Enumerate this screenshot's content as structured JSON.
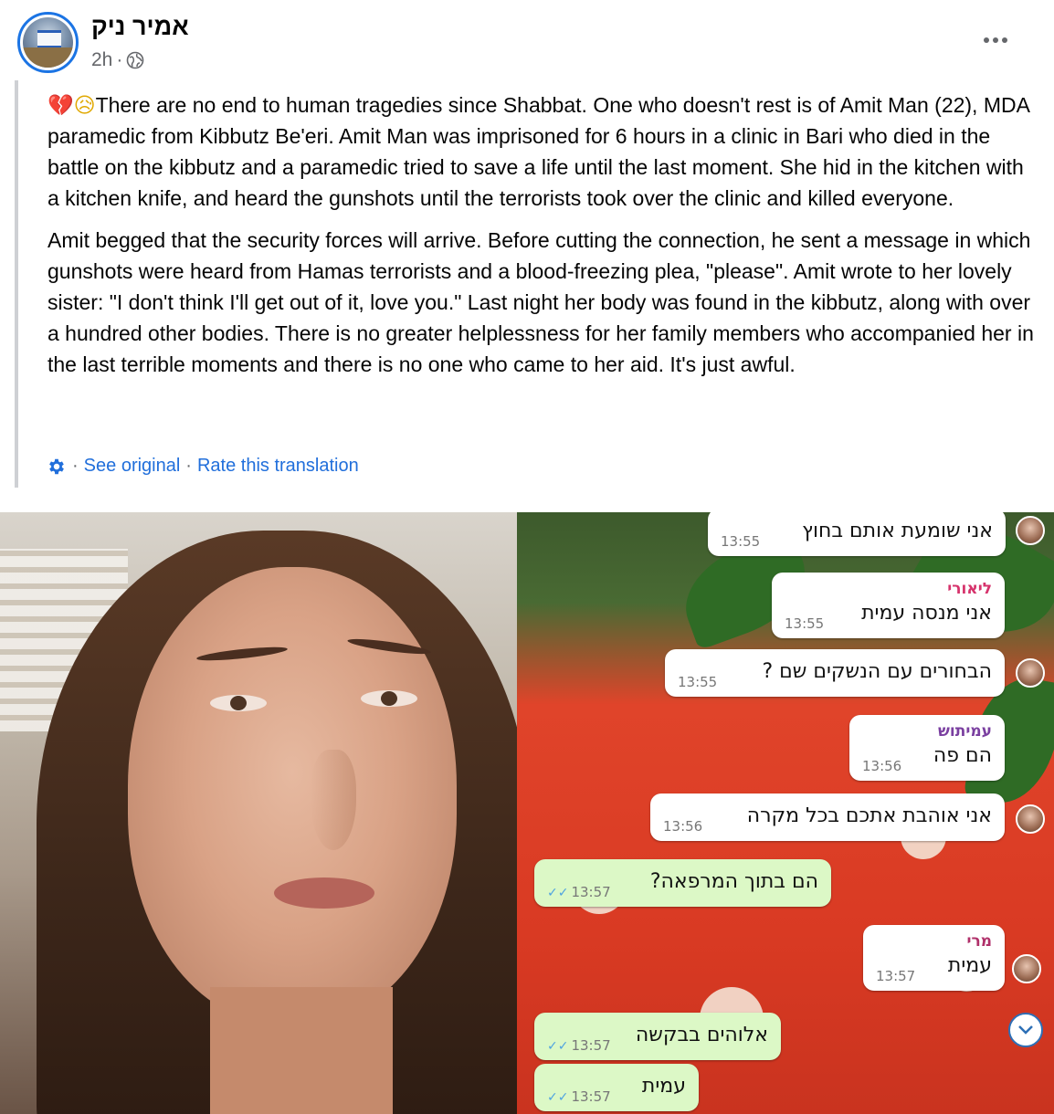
{
  "post": {
    "author": "אמיר ניק",
    "time": "2h",
    "time_separator": "·",
    "privacy_icon": "globe-icon",
    "more_icon": "more-options-icon"
  },
  "content": {
    "emoji_1": "💔",
    "emoji_2": "😥",
    "paragraph_1": "There are no end to human tragedies since Shabbat. One who doesn't rest is of Amit Man (22), MDA paramedic from Kibbutz Be'eri. Amit Man was imprisoned for 6 hours in a clinic in Bari who died in the battle on the kibbutz and a paramedic tried to save a life until the last moment. She hid in the kitchen with a kitchen knife, and heard the gunshots until the terrorists took over the clinic and killed everyone.",
    "paragraph_2": "Amit begged that the security forces will arrive. Before cutting the connection, he sent a message in which gunshots were heard from Hamas terrorists and a blood-freezing plea, \"please\". Amit wrote to her lovely sister: \"I don't think I'll get out of it, love you.\" Last night her body was found in the kibbutz, along with over a hundred other bodies. There is no greater helplessness for her family members who accompanied her in the last terrible moments and there is no one who came to her aid. It's just awful."
  },
  "translation": {
    "separator": "·",
    "see_original": "See original",
    "rate": "Rate this translation"
  },
  "chat": {
    "messages": [
      {
        "type": "in",
        "sender": "",
        "text": "אני שומעת אותם בחוץ",
        "time": "13:55"
      },
      {
        "type": "in",
        "sender": "ליאורי",
        "sender_color": "#d6336c",
        "text": "אני מנסה עמית",
        "time": "13:55"
      },
      {
        "type": "in",
        "sender": "",
        "text": "הבחורים עם הנשקים שם ?",
        "time": "13:55"
      },
      {
        "type": "in",
        "sender": "עמיתוש",
        "sender_color": "#7a3fa0",
        "text": "הם פה",
        "time": "13:56"
      },
      {
        "type": "in",
        "sender": "",
        "text": "אני אוהבת אתכם בכל מקרה",
        "time": "13:56"
      },
      {
        "type": "out",
        "sender": "",
        "text": "הם בתוך המרפאה?",
        "time": "13:57"
      },
      {
        "type": "in",
        "sender": "מרי",
        "sender_color": "#b0306a",
        "text": "עמית",
        "time": "13:57"
      },
      {
        "type": "out",
        "sender": "",
        "text": "אלוהים בבקשה",
        "time": "13:57"
      },
      {
        "type": "out",
        "sender": "",
        "text": "עמית",
        "time": "13:57"
      }
    ],
    "read_ticks": "✓✓",
    "scroll_icon": "chevron-down-icon"
  }
}
